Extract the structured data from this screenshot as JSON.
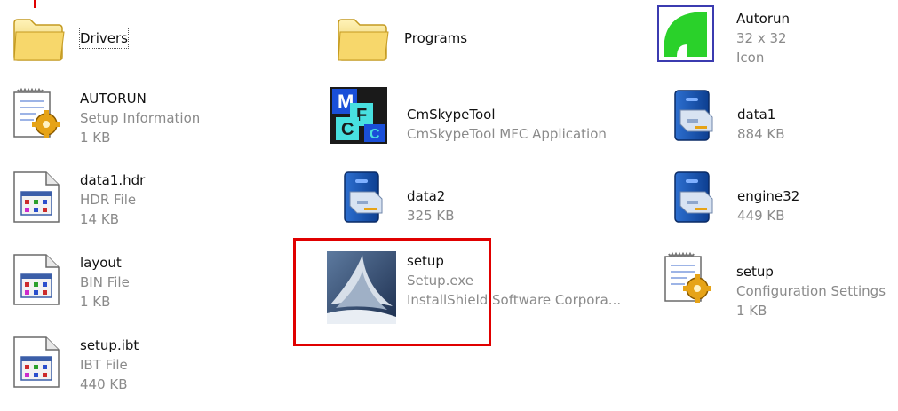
{
  "files": [
    {
      "name": "Drivers",
      "lines": [],
      "icon": "folder-icon"
    },
    {
      "name": "Programs",
      "lines": [],
      "icon": "folder-icon"
    },
    {
      "name": "Autorun",
      "lines": [
        "32 x 32",
        "Icon"
      ],
      "icon": "autorun-icon"
    },
    {
      "name": "AUTORUN",
      "lines": [
        "Setup Information",
        "1 KB"
      ],
      "icon": "setup-information-icon"
    },
    {
      "name": "CmSkypeTool",
      "lines": [
        "CmSkypeTool MFC Application"
      ],
      "icon": "mfc-application-icon"
    },
    {
      "name": "data1",
      "lines": [
        "884 KB"
      ],
      "icon": "cabinet-icon"
    },
    {
      "name": "data1.hdr",
      "lines": [
        "HDR File",
        "14 KB"
      ],
      "icon": "generic-file-icon"
    },
    {
      "name": "data2",
      "lines": [
        "325 KB"
      ],
      "icon": "cabinet-icon"
    },
    {
      "name": "engine32",
      "lines": [
        "449 KB"
      ],
      "icon": "cabinet-icon"
    },
    {
      "name": "layout",
      "lines": [
        "BIN File",
        "1 KB"
      ],
      "icon": "generic-file-icon"
    },
    {
      "name": "setup",
      "lines": [
        "Setup.exe",
        "InstallShield Software Corpora..."
      ],
      "icon": "installshield-icon"
    },
    {
      "name": "setup",
      "lines": [
        "Configuration Settings",
        "1 KB"
      ],
      "icon": "configuration-settings-icon"
    },
    {
      "name": "setup.ibt",
      "lines": [
        "IBT File",
        "440 KB"
      ],
      "icon": "generic-file-icon"
    }
  ],
  "colors": {
    "highlight": "#e00000",
    "meta_text": "#8a8a8a"
  }
}
